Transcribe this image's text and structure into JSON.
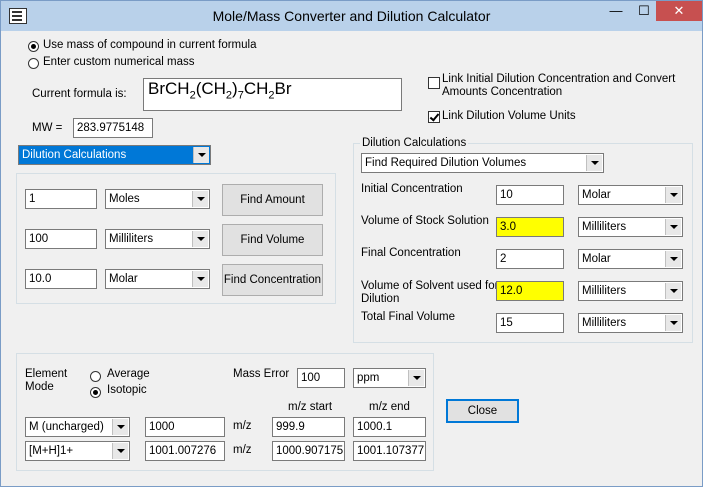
{
  "window": {
    "title": "Mole/Mass Converter and Dilution Calculator",
    "minimize": "—",
    "maximize": "☐",
    "close": "✕"
  },
  "mass_source": {
    "option1": "Use mass of compound in current formula",
    "option2": "Enter custom numerical mass"
  },
  "formula": {
    "label": "Current formula is:",
    "parts": [
      "BrCH",
      "2",
      "(CH",
      "2",
      ")",
      "7",
      "CH",
      "2",
      "Br"
    ],
    "mw_label": "MW =",
    "mw_value": "283.9775148"
  },
  "links": {
    "link1": "Link Initial Dilution Concentration and Convert Amounts Concentration",
    "link1_line1": "Link Initial Dilution Concentration and Convert",
    "link1_line2": "Amounts Concentration",
    "link2": "Link Dilution Volume Units"
  },
  "mode_select": "Dilution Calculations",
  "convert": {
    "rows": [
      {
        "value": "1",
        "unit": "Moles",
        "button": "Find Amount"
      },
      {
        "value": "100",
        "unit": "Milliliters",
        "button": "Find Volume"
      },
      {
        "value": "10.0",
        "unit": "Molar",
        "button": "Find Concentration"
      }
    ]
  },
  "dilution": {
    "group_title": "Dilution Calculations",
    "mode": "Find Required Dilution Volumes",
    "rows": [
      {
        "label": "Initial Concentration",
        "value": "10",
        "unit": "Molar"
      },
      {
        "label": "Volume of Stock Solution",
        "value": "3.0",
        "unit": "Milliliters"
      },
      {
        "label": "Final Concentration",
        "value": "2",
        "unit": "Molar"
      },
      {
        "label_line1": "Volume of Solvent used for",
        "label_line2": "Dilution",
        "value": "12.0",
        "unit": "Milliliters"
      },
      {
        "label": "Total Final Volume",
        "value": "15",
        "unit": "Milliliters"
      }
    ]
  },
  "mass_error": {
    "element_mode_line1": "Element",
    "element_mode_line2": "Mode",
    "average": "Average",
    "isotopic": "Isotopic",
    "label": "Mass Error",
    "value": "100",
    "unit": "ppm",
    "mz_start_label": "m/z start",
    "mz_end_label": "m/z end",
    "mz_unit": "m/z",
    "rows": [
      {
        "ion": "M (uncharged)",
        "mass": "1000",
        "start": "999.9",
        "end": "1000.1"
      },
      {
        "ion": "[M+H]1+",
        "mass": "1001.007276",
        "start": "1000.907175",
        "end": "1001.107377"
      }
    ]
  },
  "close_button": "Close",
  "colors": {
    "titlebar": "#b9d1ea",
    "selected_dropdown": "#0078d7",
    "highlight_field": "#ffff00",
    "close_button": "#c75050"
  }
}
